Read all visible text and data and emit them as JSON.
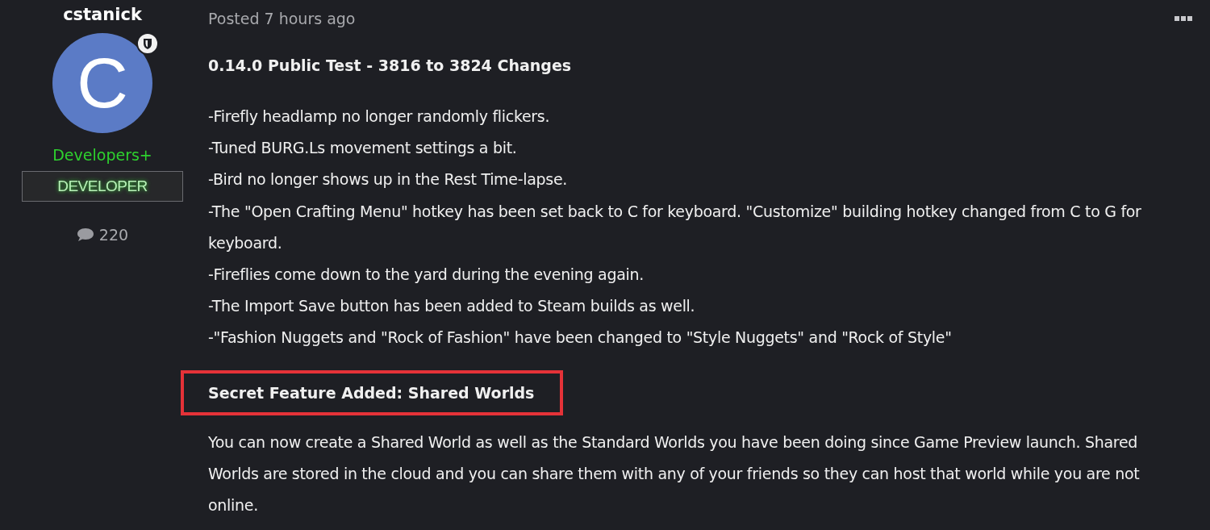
{
  "author": {
    "name": "cstanick",
    "avatar_letter": "C",
    "group": "Developers+",
    "badge": "DEVELOPER",
    "post_count": "220"
  },
  "post": {
    "timestamp": "Posted 7 hours ago",
    "title": "0.14.0 Public Test - 3816 to 3824 Changes",
    "changes": [
      "-Firefly headlamp no longer randomly flickers.",
      "-Tuned BURG.Ls movement settings a bit.",
      "-Bird no longer shows up in the Rest Time-lapse.",
      "-The \"Open Crafting Menu\" hotkey has been set back to C for keyboard. \"Customize\" building hotkey changed from C to G for keyboard.",
      "-Fireflies come down to the yard during the evening again.",
      "-The Import Save button has been added to Steam builds as well.",
      "-\"Fashion Nuggets and \"Rock of Fashion\" have been changed to \"Style Nuggets\" and \"Rock of Style\""
    ],
    "section_heading": {
      "text": "Secret Feature Added: Shared Worlds",
      "highlighted": true
    },
    "body": "You can now create a Shared World as well as the Standard Worlds you have been doing since Game Preview launch. Shared Worlds are stored in the cloud and you can share them with any of your friends so they can host that world while you are not online."
  }
}
